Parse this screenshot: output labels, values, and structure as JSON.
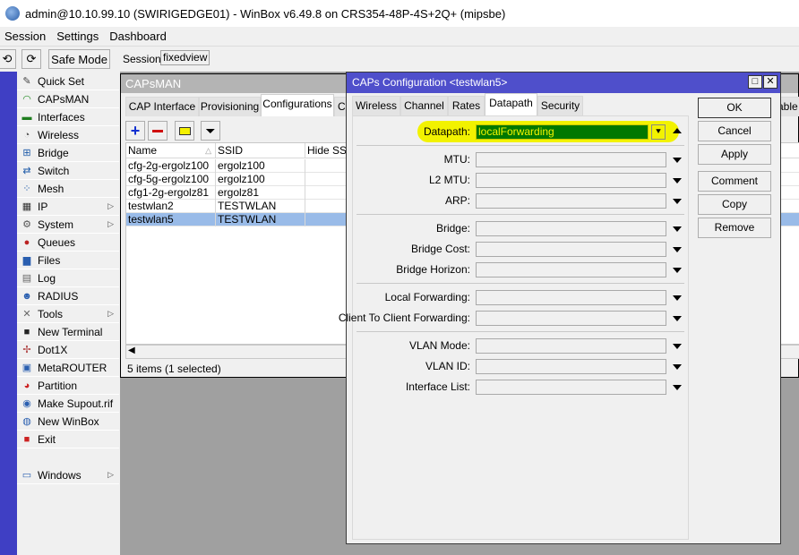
{
  "window_title": "admin@10.10.99.10 (SWIRIGEDGE01) - WinBox v6.49.8 on CRS354-48P-4S+2Q+ (mipsbe)",
  "menu": [
    "Session",
    "Settings",
    "Dashboard"
  ],
  "toolbar": {
    "undo": "⟲",
    "redo": "⟳",
    "safe_mode": "Safe Mode",
    "session_label": "Session:",
    "session_value": "fixedview"
  },
  "sidebar": [
    {
      "label": "Quick Set",
      "icon": "wand-icon",
      "glyph": "✎",
      "color": "#444"
    },
    {
      "label": "CAPsMAN",
      "icon": "capsman-icon",
      "glyph": "◠",
      "color": "#2a8f2a"
    },
    {
      "label": "Interfaces",
      "icon": "interfaces-icon",
      "glyph": "▬",
      "color": "#1e7d1e"
    },
    {
      "label": "Wireless",
      "icon": "wireless-icon",
      "glyph": "◔",
      "color": "#555"
    },
    {
      "label": "Bridge",
      "icon": "bridge-icon",
      "glyph": "⊞",
      "color": "#1d5aa8"
    },
    {
      "label": "Switch",
      "icon": "switch-icon",
      "glyph": "⇄",
      "color": "#1d5aa8"
    },
    {
      "label": "Mesh",
      "icon": "mesh-icon",
      "glyph": "⁘",
      "color": "#1d5aa8"
    },
    {
      "label": "IP",
      "icon": "ip-icon",
      "glyph": "▦",
      "color": "#333",
      "arrow": true
    },
    {
      "label": "System",
      "icon": "system-icon",
      "glyph": "⚙",
      "color": "#555",
      "arrow": true
    },
    {
      "label": "Queues",
      "icon": "queues-icon",
      "glyph": "●",
      "color": "#b22"
    },
    {
      "label": "Files",
      "icon": "files-icon",
      "glyph": "▆",
      "color": "#2a5fb0"
    },
    {
      "label": "Log",
      "icon": "log-icon",
      "glyph": "▤",
      "color": "#666"
    },
    {
      "label": "RADIUS",
      "icon": "radius-icon",
      "glyph": "☻",
      "color": "#2a5fb0"
    },
    {
      "label": "Tools",
      "icon": "tools-icon",
      "glyph": "✕",
      "color": "#666",
      "arrow": true
    },
    {
      "label": "New Terminal",
      "icon": "terminal-icon",
      "glyph": "■",
      "color": "#222"
    },
    {
      "label": "Dot1X",
      "icon": "dot1x-icon",
      "glyph": "✢",
      "color": "#a33"
    },
    {
      "label": "MetaROUTER",
      "icon": "metarouter-icon",
      "glyph": "▣",
      "color": "#2a5fb0"
    },
    {
      "label": "Partition",
      "icon": "partition-icon",
      "glyph": "◕",
      "color": "#c22"
    },
    {
      "label": "Make Supout.rif",
      "icon": "supout-icon",
      "glyph": "◉",
      "color": "#2a5fb0"
    },
    {
      "label": "New WinBox",
      "icon": "winbox-icon",
      "glyph": "◍",
      "color": "#2a5fb0"
    },
    {
      "label": "Exit",
      "icon": "exit-icon",
      "glyph": "■",
      "color": "#c22"
    },
    {
      "label": "Windows",
      "icon": "windows-icon",
      "glyph": "▭",
      "color": "#2a5fb0",
      "arrow": true
    }
  ],
  "capsman": {
    "title": "CAPsMAN",
    "tabs": [
      "CAP Interface",
      "Provisioning",
      "Configurations",
      "C",
      "able"
    ],
    "columns": [
      "Name",
      "SSID",
      "Hide SSID"
    ],
    "rows": [
      {
        "name": "cfg-2g-ergolz100",
        "ssid": "ergolz100"
      },
      {
        "name": "cfg-5g-ergolz100",
        "ssid": "ergolz100"
      },
      {
        "name": "cfg1-2g-ergolz81",
        "ssid": "ergolz81"
      },
      {
        "name": "testwlan2",
        "ssid": "TESTWLAN"
      },
      {
        "name": "testwlan5",
        "ssid": "TESTWLAN",
        "selected": true
      }
    ],
    "status": "5 items (1 selected)"
  },
  "dialog": {
    "title": "CAPs Configuration <testwlan5>",
    "tabs": [
      "Wireless",
      "Channel",
      "Rates",
      "Datapath",
      "Security"
    ],
    "active_tab": "Datapath",
    "datapath": {
      "label": "Datapath:",
      "value": "localForwarding"
    },
    "fields": [
      {
        "label": "MTU:",
        "value": ""
      },
      {
        "label": "L2 MTU:",
        "value": ""
      },
      {
        "label": "ARP:",
        "value": ""
      },
      {
        "label": "Bridge:",
        "value": ""
      },
      {
        "label": "Bridge Cost:",
        "value": ""
      },
      {
        "label": "Bridge Horizon:",
        "value": ""
      },
      {
        "label": "Local Forwarding:",
        "value": ""
      },
      {
        "label": "Client To Client Forwarding:",
        "value": ""
      },
      {
        "label": "VLAN Mode:",
        "value": ""
      },
      {
        "label": "VLAN ID:",
        "value": ""
      },
      {
        "label": "Interface List:",
        "value": ""
      }
    ],
    "buttons": [
      "OK",
      "Cancel",
      "Apply",
      "Comment",
      "Copy",
      "Remove"
    ]
  },
  "colors": {
    "highlight": "#f2f200",
    "datapath_bg": "#007800",
    "selected_row": "#99bbe8",
    "title_active": "#4f4fcb"
  }
}
